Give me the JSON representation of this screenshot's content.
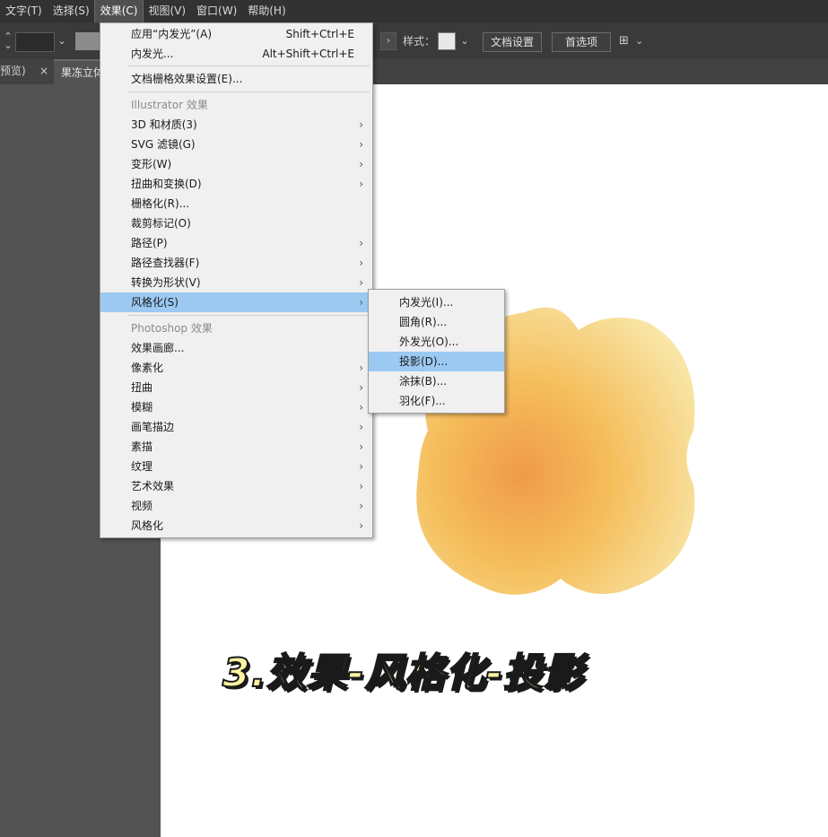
{
  "menubar": {
    "items": [
      {
        "label": "文字(T)"
      },
      {
        "label": "选择(S)"
      },
      {
        "label": "效果(C)"
      },
      {
        "label": "视图(V)"
      },
      {
        "label": "窗口(W)"
      },
      {
        "label": "帮助(H)"
      }
    ],
    "active_index": 2
  },
  "controlbar": {
    "style_label": "样式：",
    "doc_setup_label": "文档设置",
    "prefs_label": "首选项"
  },
  "tabs": [
    {
      "label": "预览)",
      "close": "×"
    },
    {
      "label": "果冻立体"
    }
  ],
  "effect_menu": {
    "items": [
      {
        "label": "应用“内发光”(A)",
        "shortcut": "Shift+Ctrl+E"
      },
      {
        "label": "内发光...",
        "shortcut": "Alt+Shift+Ctrl+E"
      },
      {
        "label": "文档栅格效果设置(E)..."
      },
      {
        "label": "Illustrator 效果"
      },
      {
        "label": "3D 和材质(3)",
        "arrow": "›"
      },
      {
        "label": "SVG 滤镜(G)",
        "arrow": "›"
      },
      {
        "label": "变形(W)",
        "arrow": "›"
      },
      {
        "label": "扭曲和变换(D)",
        "arrow": "›"
      },
      {
        "label": "栅格化(R)..."
      },
      {
        "label": "裁剪标记(O)"
      },
      {
        "label": "路径(P)",
        "arrow": "›"
      },
      {
        "label": "路径查找器(F)",
        "arrow": "›"
      },
      {
        "label": "转换为形状(V)",
        "arrow": "›"
      },
      {
        "label": "风格化(S)",
        "arrow": "›"
      },
      {
        "label": "Photoshop 效果"
      },
      {
        "label": "效果画廊..."
      },
      {
        "label": "像素化",
        "arrow": "›"
      },
      {
        "label": "扭曲",
        "arrow": "›"
      },
      {
        "label": "模糊",
        "arrow": "›"
      },
      {
        "label": "画笔描边",
        "arrow": "›"
      },
      {
        "label": "素描",
        "arrow": "›"
      },
      {
        "label": "纹理",
        "arrow": "›"
      },
      {
        "label": "艺术效果",
        "arrow": "›"
      },
      {
        "label": "视频",
        "arrow": "›"
      },
      {
        "label": "风格化",
        "arrow": "›"
      }
    ]
  },
  "stylize_submenu": {
    "items": [
      {
        "label": "内发光(I)..."
      },
      {
        "label": "圆角(R)..."
      },
      {
        "label": "外发光(O)..."
      },
      {
        "label": "投影(D)..."
      },
      {
        "label": "涂抹(B)..."
      },
      {
        "label": "羽化(F)..."
      }
    ],
    "highlighted_index": 3
  },
  "caption": "3.效果-风格化-投影",
  "colors": {
    "menu_highlight": "#9bc9f2",
    "shape_inner": "#f09a4a",
    "shape_outer": "#f8e2a0",
    "caption_fill": "#fdf3a0"
  }
}
